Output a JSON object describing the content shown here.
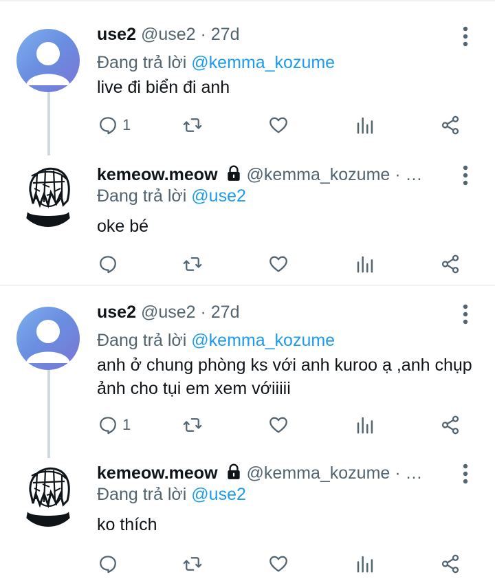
{
  "reply_prefix": "Đang trả lời",
  "colors": {
    "link": "#1d9bf0",
    "secondary": "#536471",
    "line": "#cfd9de"
  },
  "threads": [
    {
      "parent": {
        "name": "use2",
        "handle": "@use2",
        "time": "· 27d",
        "reply_to": "@kemma_kozume",
        "text": "live đi biển đi anh",
        "reply_count": "1"
      },
      "child": {
        "name": "kemeow.meow",
        "handle": "@kemma_kozume · …",
        "reply_to": "@use2",
        "text": "oke bé",
        "reply_count": ""
      }
    },
    {
      "parent": {
        "name": "use2",
        "handle": "@use2",
        "time": "· 27d",
        "reply_to": "@kemma_kozume",
        "text": "anh ở chung phòng ks với anh kuroo ạ ,anh chụp ảnh cho tụi em xem vớiiiii",
        "reply_count": "1"
      },
      "child": {
        "name": "kemeow.meow",
        "handle": "@kemma_kozume · …",
        "reply_to": "@use2",
        "text": "ko thích",
        "reply_count": ""
      }
    }
  ]
}
